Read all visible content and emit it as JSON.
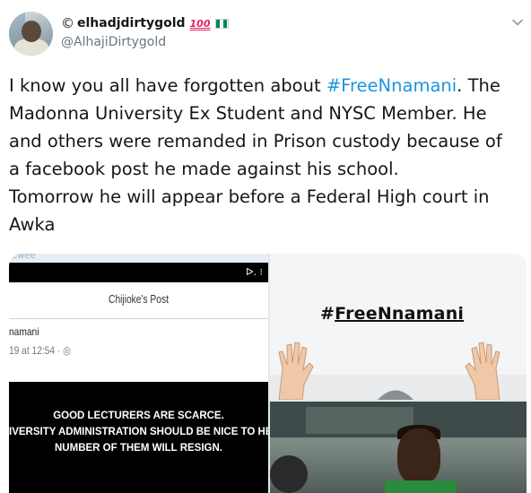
{
  "user": {
    "display_name": "elhadjdirtygold",
    "name_prefix_glyph": "©",
    "emoji_100": "100",
    "handle": "@AlhajiDirtygold"
  },
  "tweet": {
    "lines": [
      {
        "before": "I know you all have forgotten about ",
        "hashtag": "#FreeNnamani",
        "after": ". The"
      },
      {
        "text": "Madonna University Ex Student and NYSC Member. He"
      },
      {
        "text": "and others were remanded in Prison custody because of"
      },
      {
        "text": "a facebook post he made against his school."
      },
      {
        "text": "Tomorrow he will appear before a Federal High court in"
      },
      {
        "text": "Awka"
      }
    ]
  },
  "media": {
    "left": {
      "strip_text": "ewee",
      "status_icons": "ᐅ. ⁝",
      "post_title": "Chijioke's Post",
      "poster_name": "namani",
      "post_time": "19 at 12:54 · ◎",
      "body_lines": [
        "GOOD LECTURERS ARE SCARCE.",
        "IVERSITY ADMINISTRATION SHOULD BE NICE TO HER LECTURER",
        "NUMBER OF THEM WILL RESIGN."
      ]
    },
    "right_top": {
      "hashtag_image_text_prefix": "#",
      "hashtag_image_text_main": "FreeNnamani"
    }
  },
  "colors": {
    "link": "#1b95e0",
    "text": "#14171a",
    "muted": "#657786",
    "flag_green": "#008751"
  },
  "icons": {
    "caret": "chevron-down-icon",
    "flag": "nigeria-flag-icon"
  }
}
